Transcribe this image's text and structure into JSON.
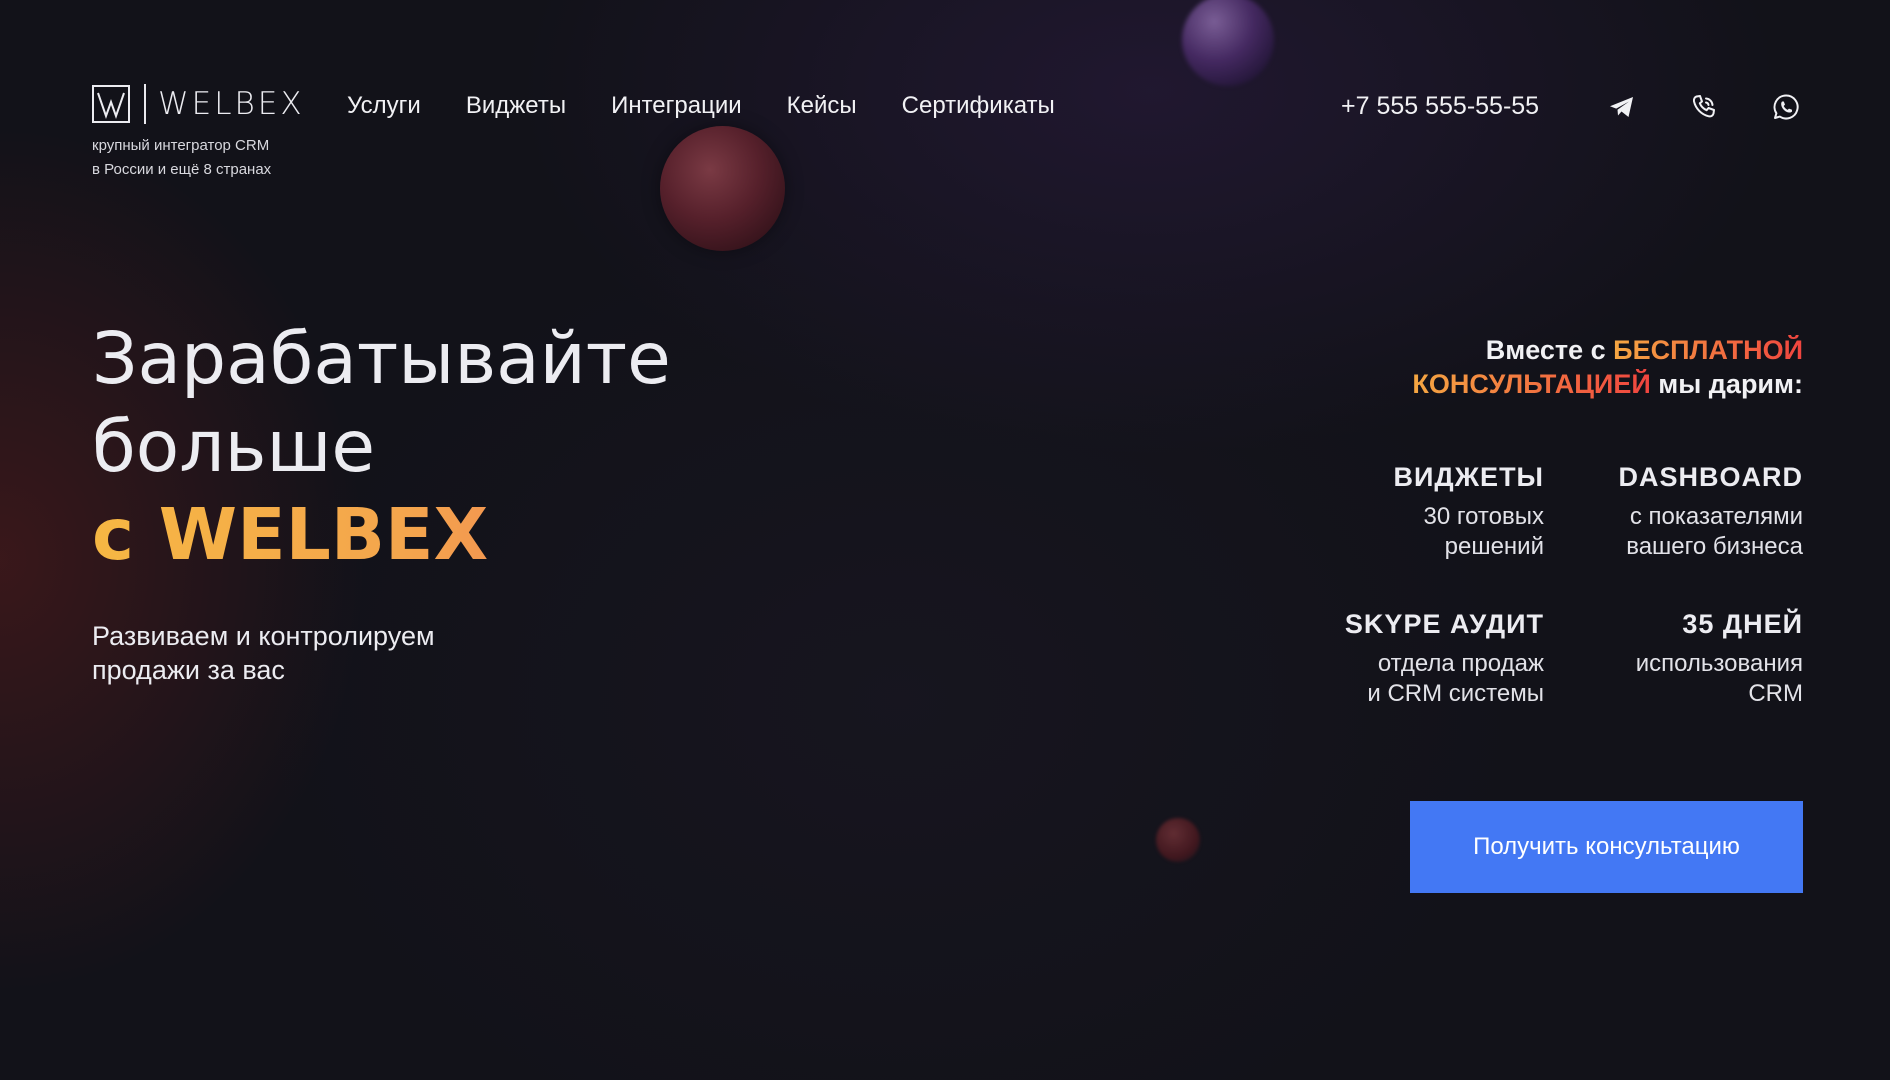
{
  "brand": {
    "name": "WELBEX",
    "tagline_line1": "крупный интегратор CRM",
    "tagline_line2": "в России и ещё 8 странах"
  },
  "nav": {
    "items": [
      {
        "label": "Услуги"
      },
      {
        "label": "Виджеты"
      },
      {
        "label": "Интеграции"
      },
      {
        "label": "Кейсы"
      },
      {
        "label": "Сертификаты"
      }
    ]
  },
  "contacts": {
    "phone": "+7 555 555-55-55",
    "icons": [
      "telegram-icon",
      "phone-call-icon",
      "whatsapp-icon"
    ]
  },
  "hero": {
    "line1": "Зарабатывайте",
    "line2": "больше",
    "line3": "с WELBEX",
    "subtitle_line1": "Развиваем и контролируем",
    "subtitle_line2": "продажи за вас"
  },
  "offer": {
    "intro": "Вместе с ",
    "free": "БЕСПЛАТНОЙ",
    "consult": "КОНСУЛЬТАЦИЕЙ",
    "outro": " мы дарим:",
    "features": [
      {
        "title": "ВИДЖЕТЫ",
        "desc_line1": "30 готовых",
        "desc_line2": "решений"
      },
      {
        "title": "DASHBOARD",
        "desc_line1": "с показателями",
        "desc_line2": "вашего бизнеса"
      },
      {
        "title": "SKYPE АУДИТ",
        "desc_line1": "отдела продаж",
        "desc_line2": "и CRM системы"
      },
      {
        "title": "35 ДНЕЙ",
        "desc_line1": "использования",
        "desc_line2": "CRM"
      }
    ]
  },
  "cta": {
    "label": "Получить консультацию"
  },
  "colors": {
    "background": "#121219",
    "accent_orange": "#f5a742",
    "accent_red": "#f0443f",
    "button": "#4378f4"
  }
}
